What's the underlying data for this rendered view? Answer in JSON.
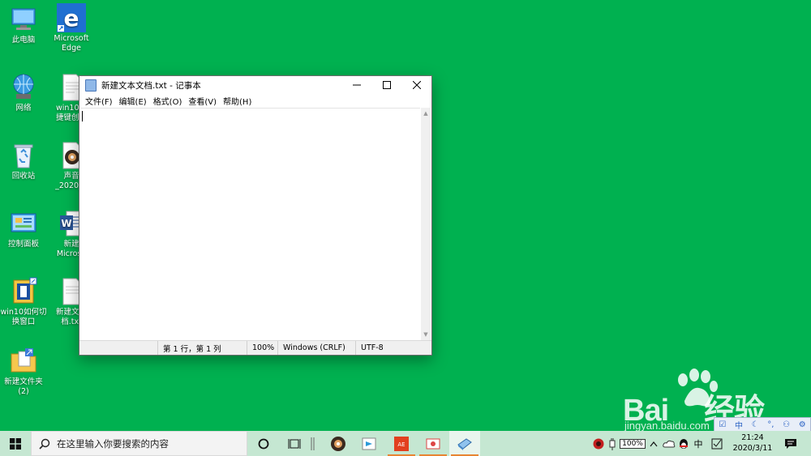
{
  "desktop": {
    "icons": [
      {
        "label": "此电脑",
        "label2": ""
      },
      {
        "label": "Microsoft",
        "label2": "Edge"
      },
      {
        "label": "网络",
        "label2": ""
      },
      {
        "label": "win10使",
        "label2": "捷键创建"
      },
      {
        "label": "回收站",
        "label2": ""
      },
      {
        "label": "声音",
        "label2": "_2020_0"
      },
      {
        "label": "控制面板",
        "label2": ""
      },
      {
        "label": "新建",
        "label2": "Microso"
      },
      {
        "label": "win10如何切",
        "label2": "换窗口"
      },
      {
        "label": "新建文本",
        "label2": "档.txt"
      },
      {
        "label": "新建文件夹",
        "label2": "(2)"
      }
    ]
  },
  "notepad": {
    "title": "新建文本文档.txt - 记事本",
    "menu": [
      "文件(F)",
      "编辑(E)",
      "格式(O)",
      "查看(V)",
      "帮助(H)"
    ],
    "status": {
      "position": "第 1 行，第 1 列",
      "zoom": "100%",
      "line_ending": "Windows (CRLF)",
      "encoding": "UTF-8"
    }
  },
  "taskbar": {
    "search_placeholder": "在这里输入你要搜索的内容",
    "battery": "100%",
    "ime_indicator": "中",
    "time": "21:24",
    "date": "2020/3/11"
  },
  "ime_toolbar": {
    "mode": "中"
  },
  "watermark": {
    "brand": "Bai",
    "brand_cn": "经验",
    "url": "jingyan.baidu.com"
  },
  "colors": {
    "desktop_bg": "#00b150",
    "taskbar_bg": "#c5e7d2",
    "active_indicator": "#e88533"
  }
}
